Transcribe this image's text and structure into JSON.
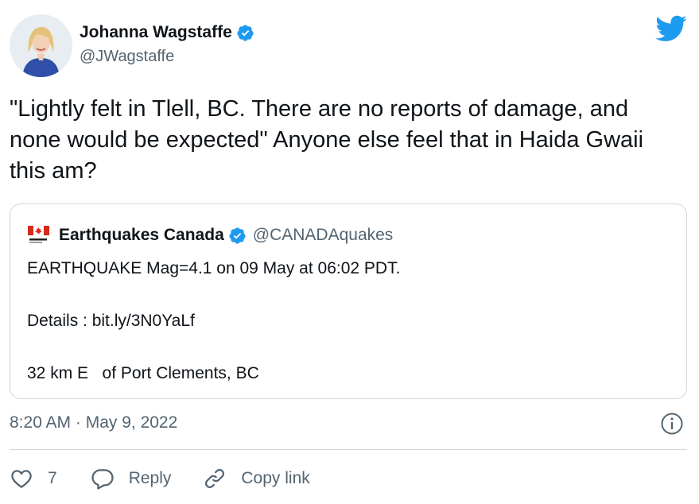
{
  "author": {
    "display_name": "Johanna Wagstaffe",
    "handle": "@JWagstaffe",
    "avatar_icon": "avatar-photo",
    "verified_icon": "verified-badge-icon"
  },
  "brand": {
    "logo_icon": "twitter-bird-icon",
    "accent_color": "#1d9bf0"
  },
  "tweet": {
    "text": "\"Lightly felt in Tlell, BC. There are no reports of damage, and none would be expected\" Anyone else feel that in Haida Gwaii this am?"
  },
  "quoted_tweet": {
    "display_name": "Earthquakes Canada",
    "handle": "@CANADAquakes",
    "flag_icon": "canada-flag-icon",
    "lines": [
      "EARTHQUAKE Mag=4.1 on 09 May at 06:02 PDT.",
      "Details : bit.ly/3N0YaLf",
      "32 km E   of Port Clements, BC"
    ]
  },
  "meta": {
    "timestamp": "8:20 AM · May 9, 2022",
    "info_icon": "info-icon"
  },
  "actions": {
    "like_count": "7",
    "reply_label": "Reply",
    "copy_link_label": "Copy link"
  },
  "colors": {
    "text": "#0f1419",
    "secondary": "#536471",
    "border": "#cfd9de",
    "canada_red": "#d52b1e"
  }
}
